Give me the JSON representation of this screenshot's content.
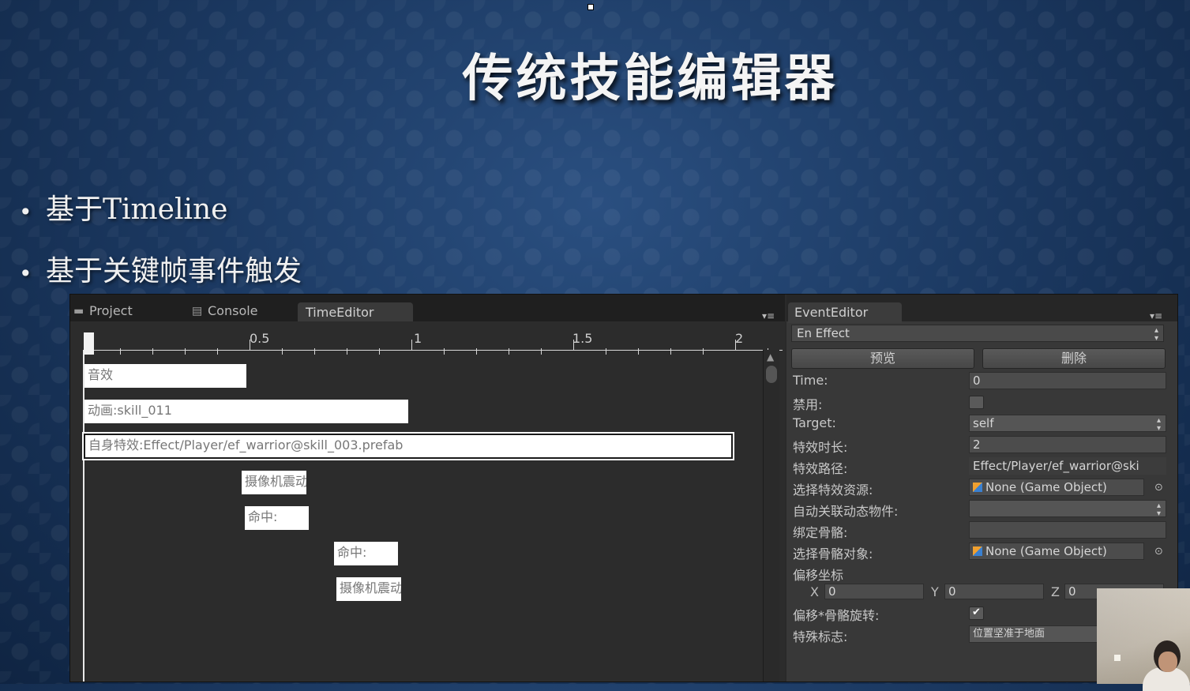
{
  "slide": {
    "title": "传统技能编辑器",
    "bullets": [
      "基于Timeline",
      "基于关键帧事件触发"
    ],
    "bullet_symbol": "•"
  },
  "editor": {
    "tabs": [
      {
        "label": "Project",
        "icon": "folder-icon"
      },
      {
        "label": "Console",
        "icon": "console-icon"
      },
      {
        "label": "TimeEditor",
        "icon": ""
      }
    ],
    "ruler_labels": [
      "0.5",
      "1",
      "1.5",
      "2"
    ],
    "playhead_label": "0",
    "tracks": [
      {
        "label": "音效"
      },
      {
        "label": "动画:skill_011"
      },
      {
        "label": "自身特效:Effect/Player/ef_warrior@skill_003.prefab",
        "selected": true
      },
      {
        "label": "摄像机震动"
      },
      {
        "label": "命中:"
      },
      {
        "label": "命中:"
      },
      {
        "label": "摄像机震动"
      }
    ]
  },
  "event_editor": {
    "tab_label": "EventEditor",
    "event_type": "En Effect",
    "buttons": {
      "preview": "预览",
      "delete": "删除"
    },
    "rows": {
      "time_label": "Time:",
      "time_value": "0",
      "disabled_label": "禁用:",
      "disabled_checked": false,
      "target_label": "Target:",
      "target_value": "self",
      "duration_label": "特效时长:",
      "duration_value": "2",
      "path_label": "特效路径:",
      "path_value": "Effect/Player/ef_warrior@ski",
      "select_res_label": "选择特效资源:",
      "select_res_value": "None (Game Object)",
      "auto_link_label": "自动关联动态物件:",
      "auto_link_value": "",
      "bind_bone_label": "绑定骨骼:",
      "bind_bone_value": "",
      "select_bone_label": "选择骨骼对象:",
      "select_bone_value": "None (Game Object)",
      "offset_label": "偏移坐标",
      "x_label": "X",
      "x_value": "0",
      "y_label": "Y",
      "y_value": "0",
      "z_label": "Z",
      "z_value": "0",
      "offset_rot_label": "偏移*骨骼旋转:",
      "offset_rot_checked": true,
      "special_label": "特殊标志:",
      "special_value": "位置坚准于地面"
    }
  }
}
